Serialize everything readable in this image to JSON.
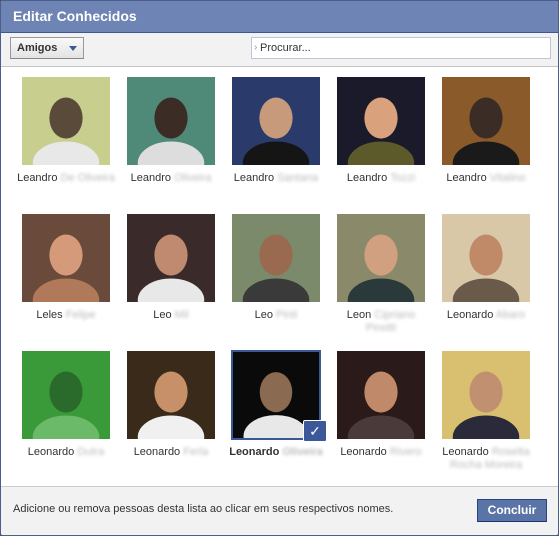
{
  "dialog": {
    "title": "Editar Conhecidos",
    "filter_label": "Amigos",
    "search_placeholder": "Procurar...",
    "footer_text": "Adicione ou remova pessoas desta lista ao clicar em seus respectivos nomes.",
    "done_label": "Concluir"
  },
  "colors": {
    "titlebar": "#6d84b4",
    "accent": "#3b5998",
    "button": "#5b74a8"
  },
  "friends": [
    {
      "first": "Leandro",
      "rest": "De Oliveira",
      "selected": false,
      "photo": {
        "bg": "#c8cf8e",
        "fg": "#5a4a3a",
        "shirt": "#e8e8e8"
      }
    },
    {
      "first": "Leandro",
      "rest": "Oliveira",
      "selected": false,
      "photo": {
        "bg": "#4f8a78",
        "fg": "#3b2d25",
        "shirt": "#dddddd"
      }
    },
    {
      "first": "Leandro",
      "rest": "Santana",
      "selected": false,
      "photo": {
        "bg": "#2a3a6a",
        "fg": "#c79a7c",
        "shirt": "#151515"
      }
    },
    {
      "first": "Leandro",
      "rest": "Tozzi",
      "selected": false,
      "photo": {
        "bg": "#1a1a2a",
        "fg": "#d9a27c",
        "shirt": "#5c5a2a"
      }
    },
    {
      "first": "Leandro",
      "rest": "Vitalino",
      "selected": false,
      "photo": {
        "bg": "#8a5a2a",
        "fg": "#3b2d25",
        "shirt": "#1a1a1a"
      }
    },
    {
      "first": "Leles",
      "rest": "Felipe",
      "selected": false,
      "photo": {
        "bg": "#6a4a3a",
        "fg": "#d49a7a",
        "shirt": "#b07a5a"
      }
    },
    {
      "first": "Leo",
      "rest": "Mil",
      "selected": false,
      "photo": {
        "bg": "#3a2a2a",
        "fg": "#c08a70",
        "shirt": "#e8e8e8"
      }
    },
    {
      "first": "Leo",
      "rest": "Pinti",
      "selected": false,
      "photo": {
        "bg": "#7a8a6a",
        "fg": "#9a6a50",
        "shirt": "#3a3a3a"
      }
    },
    {
      "first": "Leon",
      "rest": "Cipriano Pinotti",
      "selected": false,
      "photo": {
        "bg": "#8a8a6a",
        "fg": "#d0a080",
        "shirt": "#2a3a3a"
      }
    },
    {
      "first": "Leonardo",
      "rest": "Abaro",
      "selected": false,
      "photo": {
        "bg": "#d8c8a8",
        "fg": "#c08a68",
        "shirt": "#6a5a4a"
      }
    },
    {
      "first": "Leonardo",
      "rest": "Dutra",
      "selected": false,
      "photo": {
        "bg": "#3a9a3a",
        "fg": "#2a6a2a",
        "shirt": "#6aba6a"
      }
    },
    {
      "first": "Leonardo",
      "rest": "Ferla",
      "selected": false,
      "photo": {
        "bg": "#3a2a1a",
        "fg": "#c89068",
        "shirt": "#f0f0f0"
      }
    },
    {
      "first": "Leonardo",
      "rest": "Oliveira",
      "selected": true,
      "photo": {
        "bg": "#0a0a0a",
        "fg": "#8a6a50",
        "shirt": "#e8e8e8"
      }
    },
    {
      "first": "Leonardo",
      "rest": "Rivero",
      "selected": false,
      "photo": {
        "bg": "#2a1a1a",
        "fg": "#c08a6a",
        "shirt": "#4a3a3a"
      }
    },
    {
      "first": "Leonardo",
      "rest": "Rosetta Rocha Moreira",
      "selected": false,
      "photo": {
        "bg": "#d8c070",
        "fg": "#c09070",
        "shirt": "#2a2a3a"
      }
    }
  ]
}
